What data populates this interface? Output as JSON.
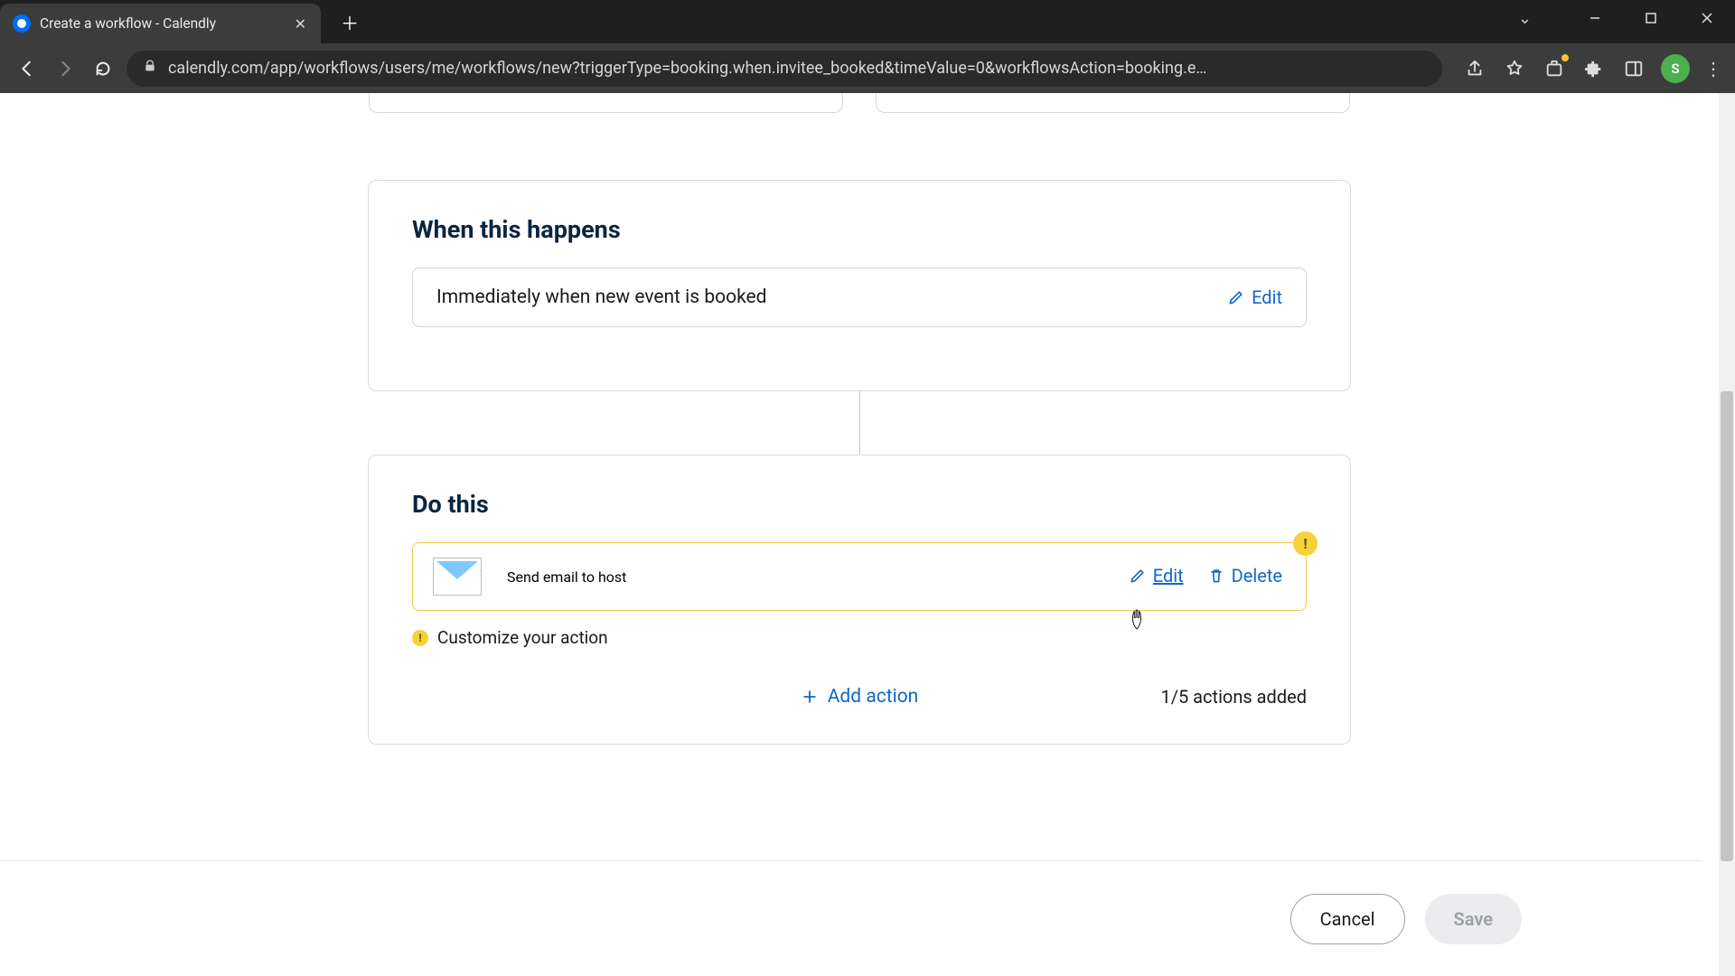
{
  "browser": {
    "tab_title": "Create a workflow - Calendly",
    "url": "calendly.com/app/workflows/users/me/workflows/new?triggerType=booking.when.invitee_booked&timeValue=0&workflowsAction=booking.e…",
    "avatar_initial": "S"
  },
  "trigger": {
    "section_title": "When this happens",
    "description": "Immediately when new event is booked",
    "edit_label": "Edit"
  },
  "action": {
    "section_title": "Do this",
    "item_label": "Send email to host",
    "edit_label": "Edit",
    "delete_label": "Delete",
    "badge_char": "!",
    "customize_label": "Customize your action",
    "add_action_label": "Add action",
    "actions_count_label": "1/5 actions added"
  },
  "footer": {
    "cancel_label": "Cancel",
    "save_label": "Save"
  }
}
